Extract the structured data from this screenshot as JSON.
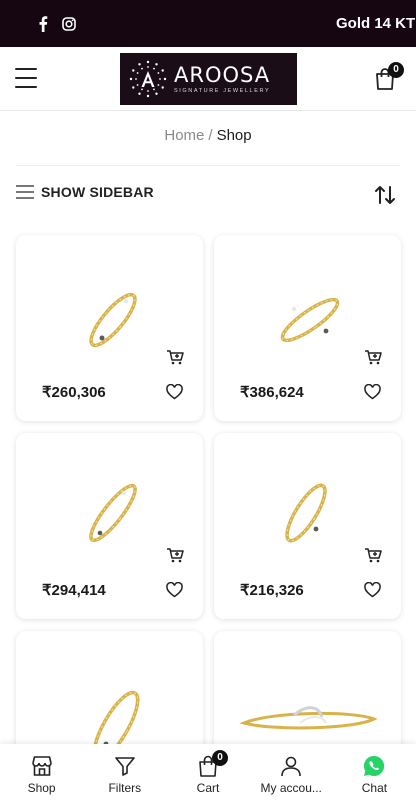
{
  "topbar": {
    "ticker": "Gold 14 KT",
    "social": [
      "facebook-icon",
      "instagram-icon"
    ],
    "background": "#150612"
  },
  "header": {
    "brand": "AROOSA",
    "tagline": "SIGNATURE JEWELLERY",
    "cart_count": "0"
  },
  "breadcrumb": {
    "home": "Home",
    "separator": "/",
    "current": "Shop"
  },
  "toolbar": {
    "sidebar_label": "SHOW SIDEBAR"
  },
  "products": [
    {
      "price": "₹260,306"
    },
    {
      "price": "₹386,624"
    },
    {
      "price": "₹294,414"
    },
    {
      "price": "₹216,326"
    },
    {
      "price": ""
    },
    {
      "price": ""
    }
  ],
  "bottom_nav": {
    "items": [
      {
        "label": "Shop",
        "icon": "store-icon"
      },
      {
        "label": "Filters",
        "icon": "filter-icon"
      },
      {
        "label": "Cart",
        "icon": "bag-icon"
      },
      {
        "label": "My accou...",
        "icon": "user-icon"
      },
      {
        "label": "Chat",
        "icon": "whatsapp-icon"
      }
    ],
    "cart_badge": "0"
  },
  "colors": {
    "accent_dark": "#150612",
    "whatsapp": "#25D366",
    "gold": "#d9b24a"
  }
}
